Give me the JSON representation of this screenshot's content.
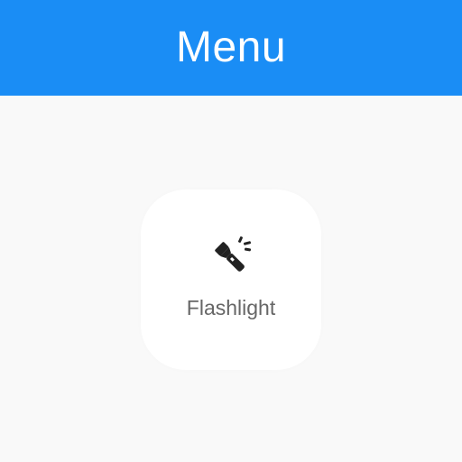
{
  "header": {
    "title": "Menu",
    "background_color": "#1a8df5"
  },
  "menu": {
    "items": [
      {
        "label": "Flashlight",
        "icon": "flashlight-icon"
      }
    ]
  },
  "colors": {
    "page_background": "#f9f9f9",
    "tile_background": "#ffffff",
    "label_color": "#666666",
    "icon_color": "#222222"
  }
}
